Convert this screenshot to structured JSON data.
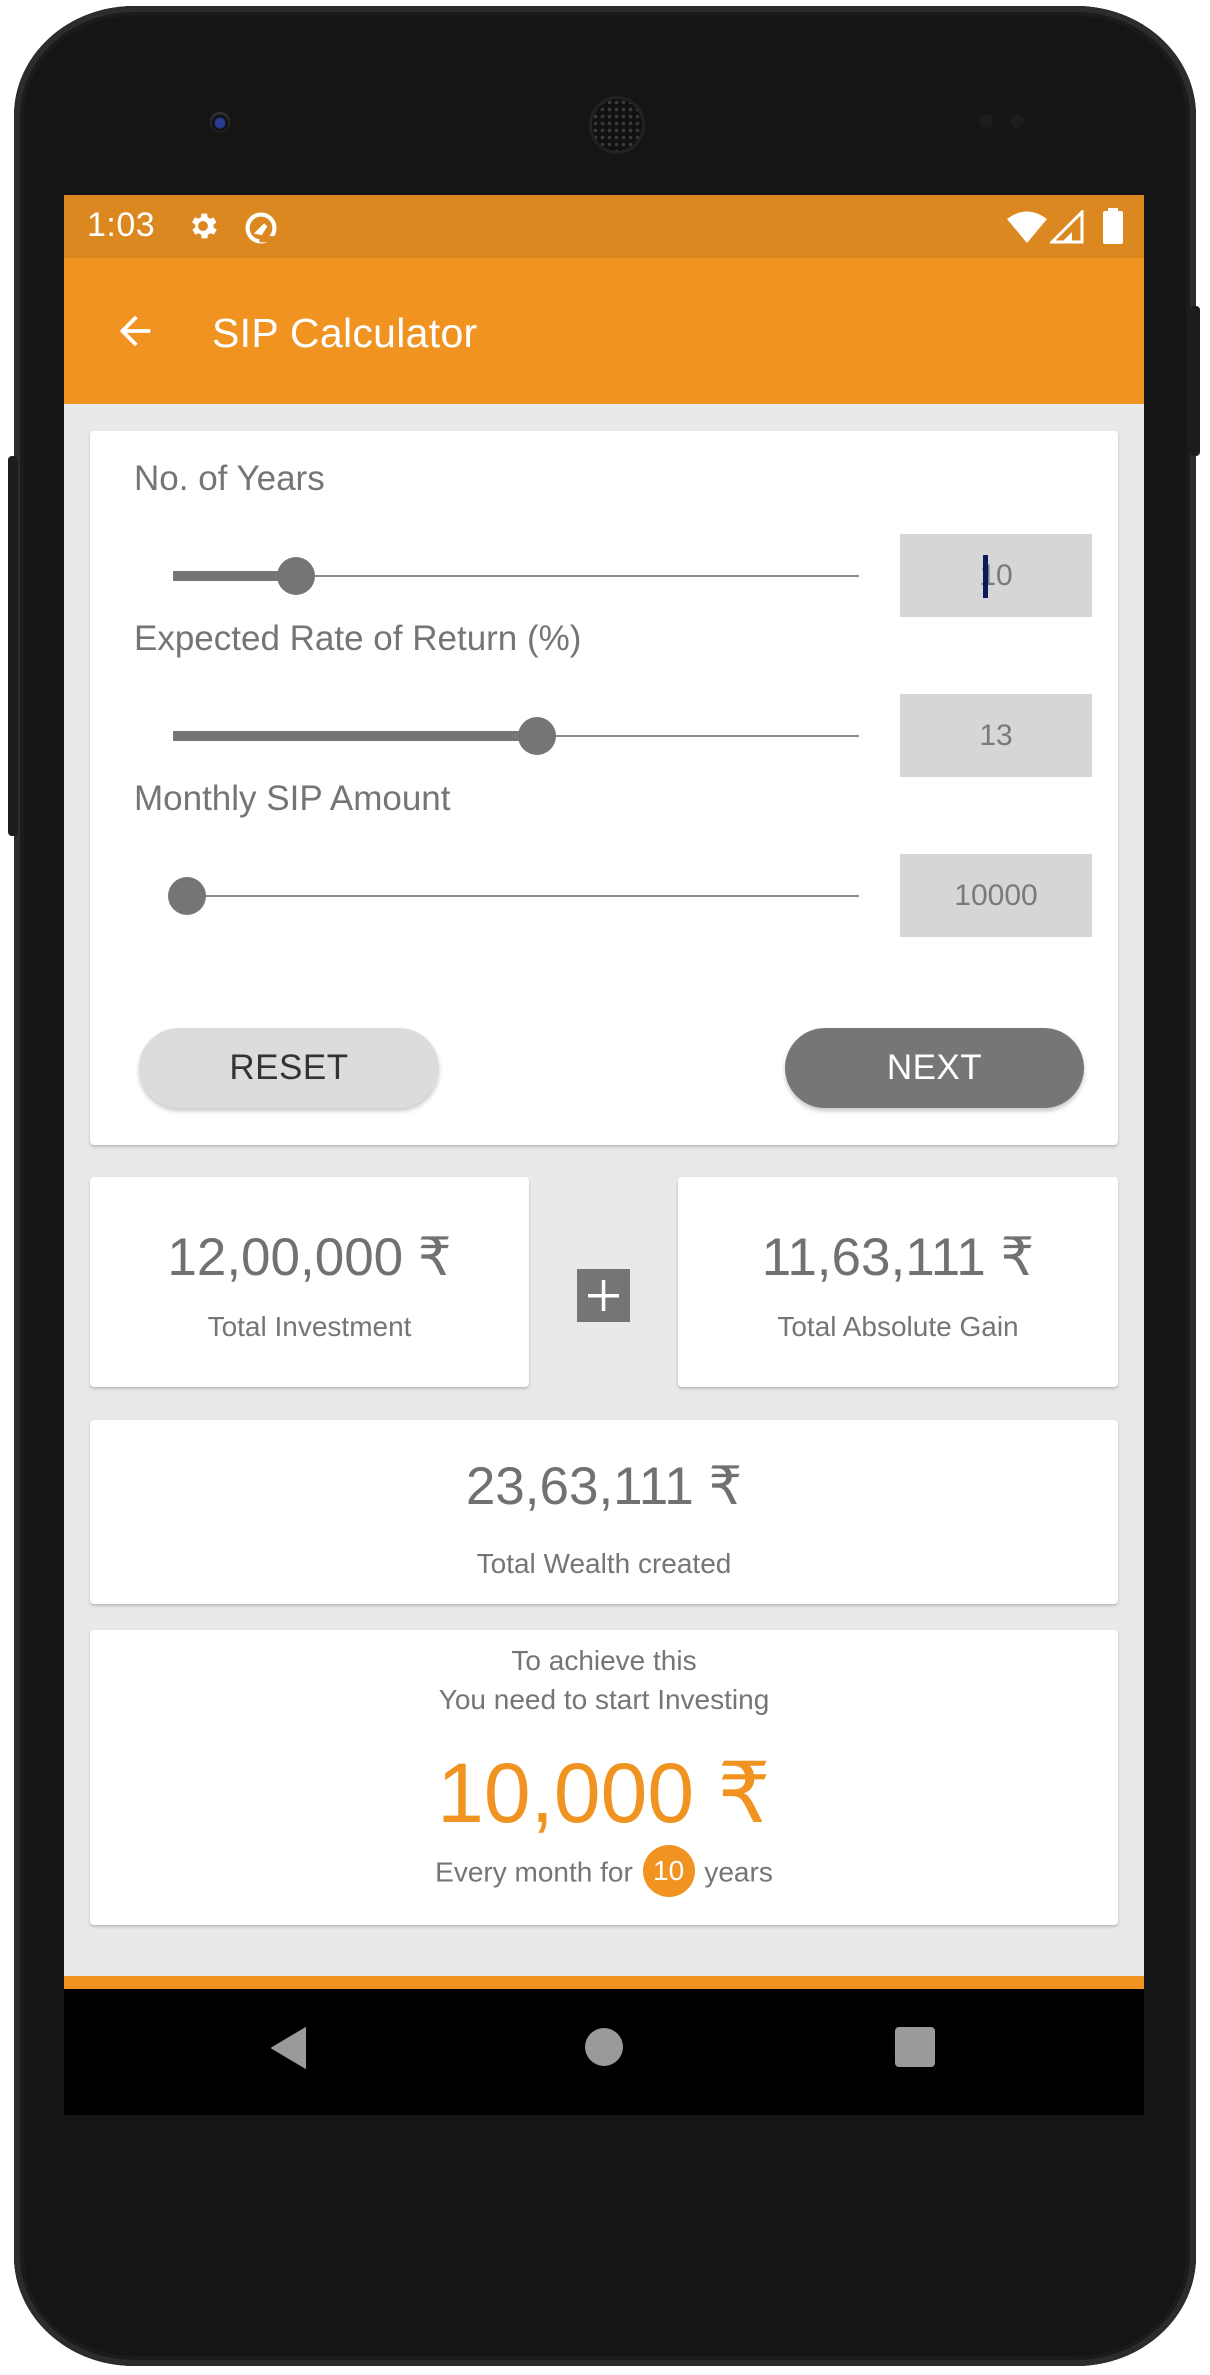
{
  "status_bar": {
    "time": "1:03",
    "left_icons": [
      "settings-gear-icon",
      "data-saver-icon"
    ],
    "right_icons": [
      "wifi-icon",
      "cell-signal-icon",
      "battery-icon"
    ]
  },
  "toolbar": {
    "back_icon": "arrow-back-icon",
    "title": "SIP Calculator"
  },
  "inputs_card": {
    "fields": [
      {
        "label": "No. of Years",
        "value": "10",
        "slider_fraction": 0.18,
        "focused": true
      },
      {
        "label": "Expected Rate of Return (%)",
        "value": "13",
        "slider_fraction": 0.53,
        "focused": false
      },
      {
        "label": "Monthly SIP Amount",
        "value": "10000",
        "slider_fraction": 0.02,
        "focused": false
      }
    ],
    "reset_label": "RESET",
    "next_label": "NEXT"
  },
  "results": {
    "investment": {
      "amount": "12,00,000 ₹",
      "label": "Total Investment"
    },
    "operator_icon": "plus-icon",
    "gain": {
      "amount": "11,63,111 ₹",
      "label": "Total Absolute Gain"
    },
    "wealth": {
      "amount": "23,63,111 ₹",
      "label": "Total Wealth created"
    }
  },
  "summary": {
    "line1": "To achieve this",
    "line2": "You need to start Investing",
    "amount": "10,000 ₹",
    "prefix": "Every month for",
    "years": "10",
    "suffix": "years"
  },
  "nav_bar": {
    "icons": [
      "nav-back-icon",
      "nav-home-icon",
      "nav-recents-icon"
    ]
  },
  "colors": {
    "accent": "#f09320",
    "status_bar": "#dc8820",
    "text_gray": "#757575",
    "input_bg": "#d6d6d6",
    "next_button": "#767676",
    "reset_button": "#dcdcdc"
  }
}
